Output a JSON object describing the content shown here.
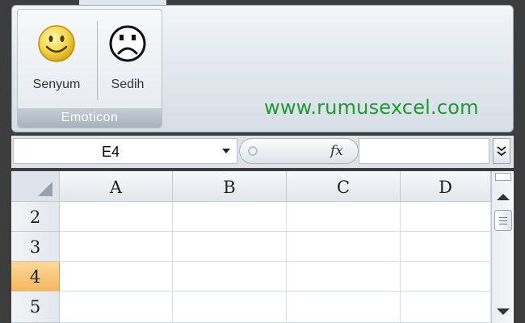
{
  "ribbon": {
    "group_label": "Emoticon",
    "buttons": [
      {
        "label": "Senyum",
        "icon": "smiley-icon"
      },
      {
        "label": "Sedih",
        "icon": "sad-face-icon"
      }
    ],
    "brand_text": "www.rumusexcel.com"
  },
  "formula_bar": {
    "name_box_value": "E4",
    "fx_label": "fx",
    "formula_value": ""
  },
  "sheet": {
    "columns": [
      "A",
      "B",
      "C",
      "D"
    ],
    "rows": [
      "2",
      "3",
      "4",
      "5"
    ],
    "selected_row": "4"
  },
  "colors": {
    "brand": "#1f9a2e",
    "selected_row_header": "#f5b760"
  }
}
